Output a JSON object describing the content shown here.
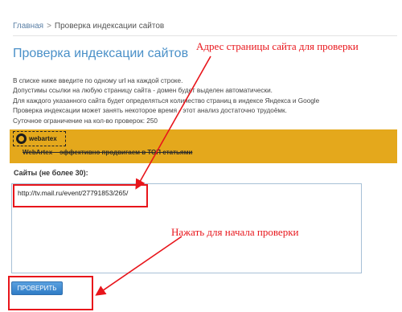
{
  "breadcrumb": {
    "home": "Главная",
    "separator": ">",
    "current": "Проверка индексации сайтов"
  },
  "page_title": "Проверка индексации сайтов",
  "description": [
    "В списке ниже введите по одному url на каждой строке.",
    "Допустимы ссылки на любую страницу сайта - домен будет выделен автоматически.",
    "Для каждого указанного сайта будет определяться количество страниц в индексе Яндекса и Google",
    "Проверка индексации может занять некоторое время - этот анализ достаточно трудоёмк.",
    "Суточное ограничение на кол-во проверок: 250"
  ],
  "banner": {
    "logo_text": "webartex",
    "text": "WebArtex – эффективно продвигаем в ТОП статьями",
    "background": "#e4a81c"
  },
  "form": {
    "sites_label": "Сайты (не более 30):",
    "sites_value": "http://tv.mail.ru/event/27791853/265/",
    "submit_label": "ПРОВЕРИТЬ"
  },
  "annotations": {
    "address_hint": "Адрес страницы сайта для проверки",
    "start_hint": "Нажать для начала проверки",
    "color": "#e8151b"
  }
}
